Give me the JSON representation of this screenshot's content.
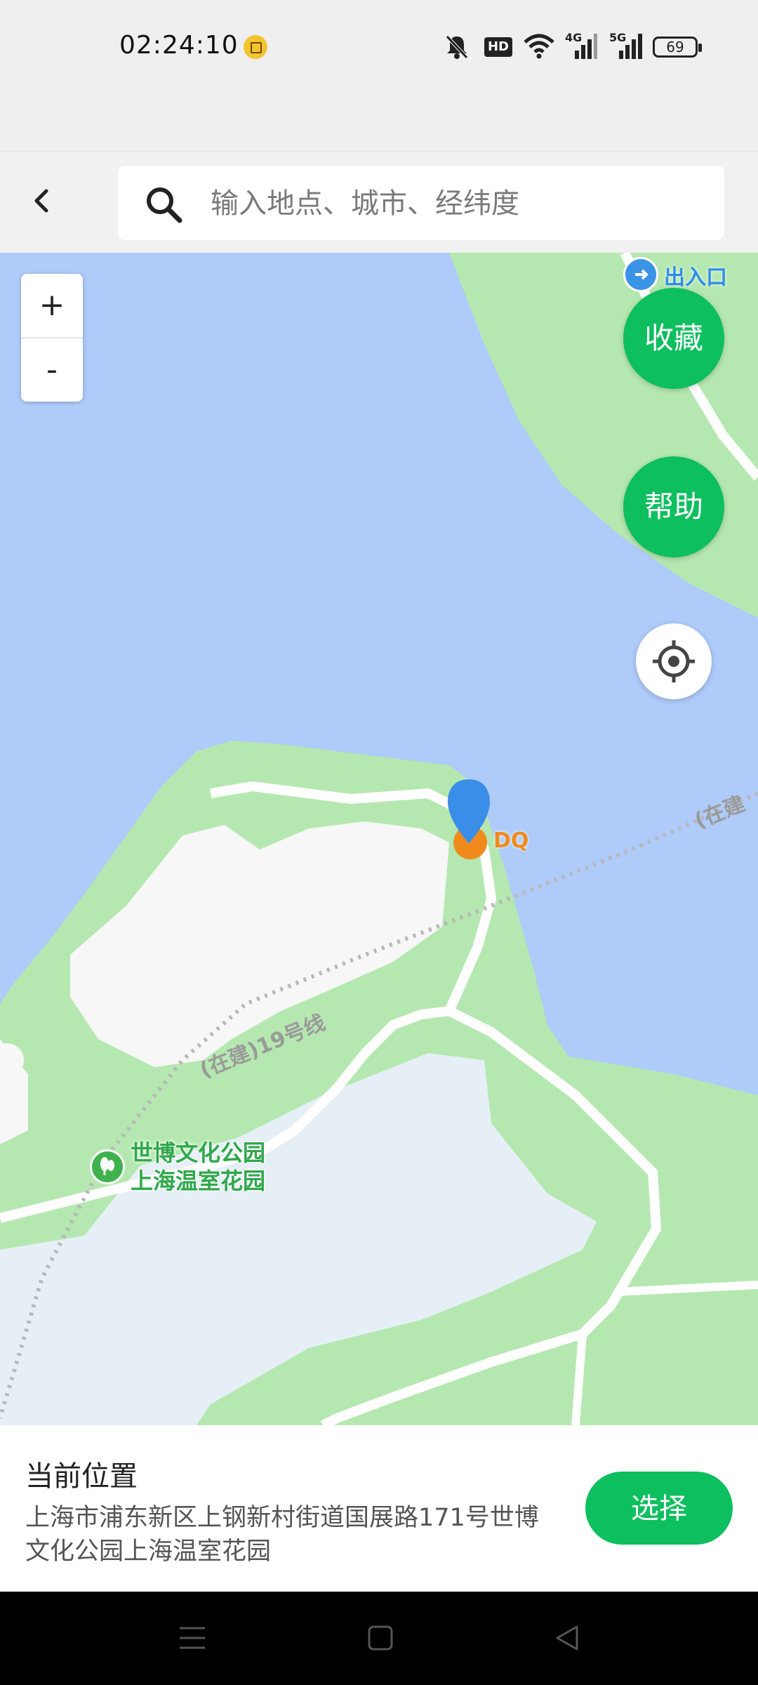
{
  "status_bar": {
    "time": "02:24:10",
    "icons": [
      "mute-icon",
      "hd-icon",
      "wifi-icon",
      "4g-signal-icon",
      "5g-signal-icon"
    ],
    "hd_label": "HD",
    "net_4g": "4G",
    "net_5g": "5G",
    "battery": "69"
  },
  "header": {
    "search_placeholder": "输入地点、城市、经纬度"
  },
  "map": {
    "zoom_in": "+",
    "zoom_out": "-",
    "favorite_label": "收藏",
    "help_label": "帮助",
    "exit_label": "出入口",
    "marker_label": "DQ",
    "poi_name_line1": "世博文化公园",
    "poi_name_line2": "上海温室花园",
    "metro_label": "(在建)19号线",
    "metro_label_partial": "(在建",
    "colors": {
      "water": "#aecbfa",
      "green": "#b5e8b0",
      "accent": "#0dbf5e"
    }
  },
  "panel": {
    "title": "当前位置",
    "address": "上海市浦东新区上钢新村街道国展路171号世博文化公园上海温室花园",
    "select_label": "选择"
  },
  "navbar": {
    "icons": [
      "menu-icon",
      "home-icon",
      "back-triangle-icon"
    ]
  }
}
